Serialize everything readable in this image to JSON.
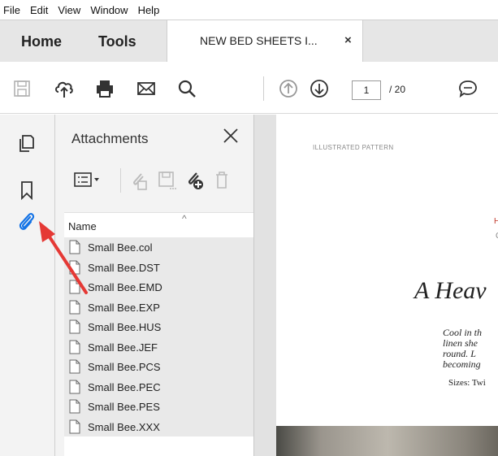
{
  "menu": [
    "File",
    "Edit",
    "View",
    "Window",
    "Help"
  ],
  "tabs": {
    "home": "Home",
    "tools": "Tools",
    "doc_title": "NEW BED SHEETS I...",
    "doc_close": "×"
  },
  "toolbar": {
    "icons": [
      "save-icon",
      "upload-cloud-icon",
      "print-icon",
      "email-icon",
      "search-icon",
      "page-up-icon",
      "page-down-icon",
      "comment-icon"
    ],
    "page_current": "1",
    "page_total": "/ 20"
  },
  "rail": {
    "icons": [
      "pages-icon",
      "bookmark-icon",
      "attachment-paperclip-icon"
    ]
  },
  "attachments": {
    "title": "Attachments",
    "close": "close-icon",
    "column_name": "Name",
    "sort_indicator": "^",
    "files": [
      "Small Bee.col",
      "Small Bee.DST",
      "Small Bee.EMD",
      "Small Bee.EXP",
      "Small Bee.HUS",
      "Small Bee.JEF",
      "Small Bee.PCS",
      "Small Bee.PEC",
      "Small Bee.PES",
      "Small Bee.XXX"
    ]
  },
  "document": {
    "label": "ILLUSTRATED PATTERN",
    "red_char": "H",
    "grey_char": "C",
    "heading": "A Heav",
    "body_lines": [
      "Cool in th",
      "linen she",
      "round. L",
      "becoming"
    ],
    "sizes": "Sizes: Twi"
  },
  "colors": {
    "accent": "#1473e6",
    "arrow": "#e53935",
    "tabbar": "#e6e6e6",
    "panel": "#f3f3f3"
  }
}
